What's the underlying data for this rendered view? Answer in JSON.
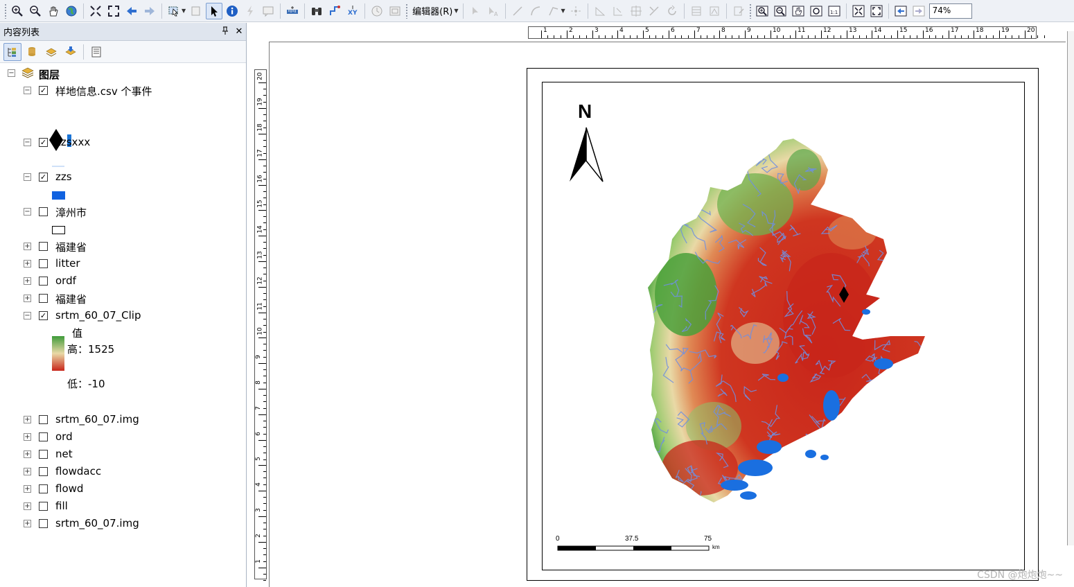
{
  "toolbar": {
    "editor_label": "编辑器(R)",
    "zoom_value": "74%"
  },
  "toc": {
    "title": "内容列表",
    "pin_glyph": "ᵖ",
    "close_glyph": "✕",
    "root_label": "图层",
    "layers": [
      {
        "label": "样地信息.csv 个事件",
        "checked": true,
        "expanded": true
      },
      {
        "label": "zzsxxx",
        "checked": true,
        "expanded": true
      },
      {
        "label": "zzs",
        "checked": true,
        "expanded": true
      },
      {
        "label": "漳州市",
        "checked": false,
        "expanded": true
      },
      {
        "label": "福建省",
        "checked": false,
        "expanded": false
      },
      {
        "label": "litter",
        "checked": false,
        "expanded": false
      },
      {
        "label": "ordf",
        "checked": false,
        "expanded": false
      },
      {
        "label": "福建省",
        "checked": false,
        "expanded": false
      },
      {
        "label": "srtm_60_07_Clip",
        "checked": true,
        "expanded": true
      },
      {
        "label": "srtm_60_07.img",
        "checked": false,
        "expanded": false
      },
      {
        "label": "ord",
        "checked": false,
        "expanded": false
      },
      {
        "label": "net",
        "checked": false,
        "expanded": false
      },
      {
        "label": "flowdacc",
        "checked": false,
        "expanded": false
      },
      {
        "label": "flowd",
        "checked": false,
        "expanded": false
      },
      {
        "label": "fill",
        "checked": false,
        "expanded": false
      },
      {
        "label": "srtm_60_07.img",
        "checked": false,
        "expanded": false
      }
    ],
    "legend": {
      "field_label": "值",
      "high_label": "高：1525",
      "low_label": "低：-10",
      "high_color": "#3f9b3a",
      "low_color": "#c8251a"
    }
  },
  "map": {
    "north_label": "N",
    "scale_labels": [
      "0",
      "37.5",
      "75"
    ],
    "scale_unit": "km",
    "ruler_top": [
      "1",
      "2",
      "3",
      "4",
      "5",
      "6",
      "7",
      "8",
      "9",
      "10",
      "11",
      "12",
      "13",
      "14",
      "15",
      "16",
      "17",
      "18",
      "19",
      "20"
    ],
    "ruler_left": [
      "20",
      "19",
      "18",
      "17",
      "16",
      "15",
      "14",
      "13",
      "12",
      "11",
      "10",
      "9",
      "8",
      "7",
      "6",
      "5",
      "4",
      "3",
      "2",
      "1"
    ],
    "colors": {
      "low": "#c8251a",
      "mid": "#e88a5a",
      "light": "#e9d9a6",
      "high": "#3f9b3a",
      "water": "#1a6fe0",
      "river": "#6f8fe2"
    }
  },
  "watermark": "CSDN @炮炮炮~~"
}
